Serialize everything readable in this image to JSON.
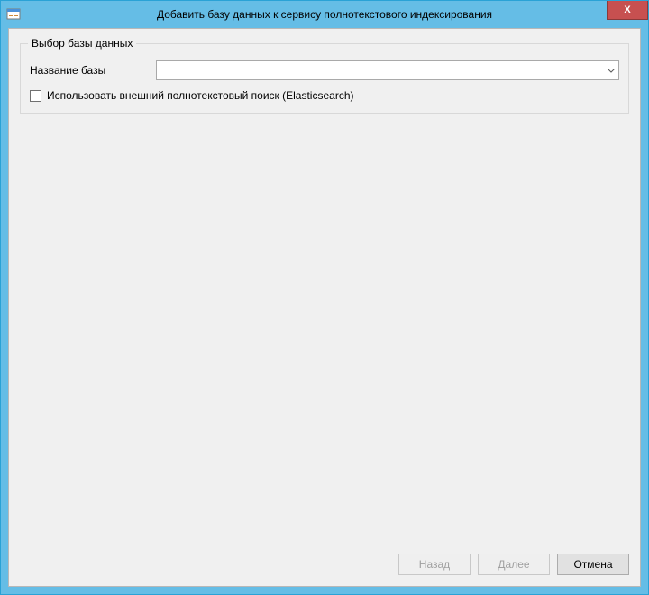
{
  "titlebar": {
    "title": "Добавить базу данных к сервису полнотекстового индексирования",
    "close_glyph": "X"
  },
  "groupbox": {
    "title": "Выбор базы данных",
    "db_name_label": "Название базы",
    "db_name_value": "",
    "checkbox_label": "Использовать внешний полнотекстовый поиск (Elasticsearch)",
    "checkbox_checked": false
  },
  "buttons": {
    "back": "Назад",
    "next": "Далее",
    "cancel": "Отмена"
  }
}
